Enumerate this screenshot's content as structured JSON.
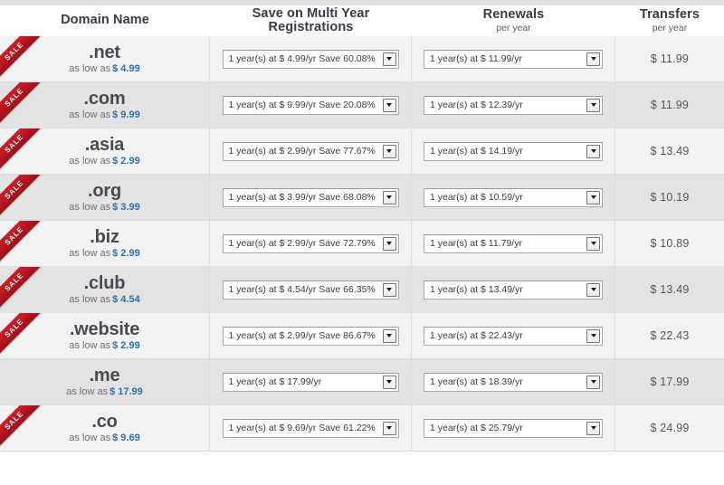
{
  "header": {
    "columns": [
      {
        "main": "Domain Name",
        "sub": ""
      },
      {
        "main": "Save on Multi Year Registrations",
        "sub": ""
      },
      {
        "main": "Renewals",
        "sub": "per year"
      },
      {
        "main": "Transfers",
        "sub": "per year"
      }
    ]
  },
  "labels": {
    "as_low_as": "as low as",
    "sale_badge": "SALE"
  },
  "colors": {
    "sale_red": "#b5151f",
    "price_blue": "#2f6fa8",
    "row_bg": "#f2f2f2",
    "row_bg_alt": "#e3e3e3"
  },
  "rows": [
    {
      "tld": ".net",
      "sale": true,
      "low_price": "$ 4.99",
      "multi": "1 year(s) at $ 4.99/yr  Save 60.08%",
      "renewal": "1 year(s) at $ 11.99/yr",
      "transfer": "$ 11.99"
    },
    {
      "tld": ".com",
      "sale": true,
      "low_price": "$ 9.99",
      "multi": "1 year(s) at $ 9.99/yr  Save 20.08%",
      "renewal": "1 year(s) at $ 12.39/yr",
      "transfer": "$ 11.99"
    },
    {
      "tld": ".asia",
      "sale": true,
      "low_price": "$ 2.99",
      "multi": "1 year(s) at $ 2.99/yr  Save 77.67%",
      "renewal": "1 year(s) at $ 14.19/yr",
      "transfer": "$ 13.49"
    },
    {
      "tld": ".org",
      "sale": true,
      "low_price": "$ 3.99",
      "multi": "1 year(s) at $ 3.99/yr  Save 68.08%",
      "renewal": "1 year(s) at $ 10.59/yr",
      "transfer": "$ 10.19"
    },
    {
      "tld": ".biz",
      "sale": true,
      "low_price": "$ 2.99",
      "multi": "1 year(s) at $ 2.99/yr  Save 72.79%",
      "renewal": "1 year(s) at $ 11.79/yr",
      "transfer": "$ 10.89"
    },
    {
      "tld": ".club",
      "sale": true,
      "low_price": "$ 4.54",
      "multi": "1 year(s) at $ 4.54/yr  Save 66.35%",
      "renewal": "1 year(s) at $ 13.49/yr",
      "transfer": "$ 13.49"
    },
    {
      "tld": ".website",
      "sale": true,
      "low_price": "$ 2.99",
      "multi": "1 year(s) at $ 2.99/yr  Save 86.67%",
      "renewal": "1 year(s) at $ 22.43/yr",
      "transfer": "$ 22.43"
    },
    {
      "tld": ".me",
      "sale": false,
      "low_price": "$ 17.99",
      "multi": "1 year(s) at $ 17.99/yr",
      "renewal": "1 year(s) at $ 18.39/yr",
      "transfer": "$ 17.99"
    },
    {
      "tld": ".co",
      "sale": true,
      "low_price": "$ 9.69",
      "multi": "1 year(s) at $ 9.69/yr  Save 61.22%",
      "renewal": "1 year(s) at $ 25.79/yr",
      "transfer": "$ 24.99"
    }
  ]
}
